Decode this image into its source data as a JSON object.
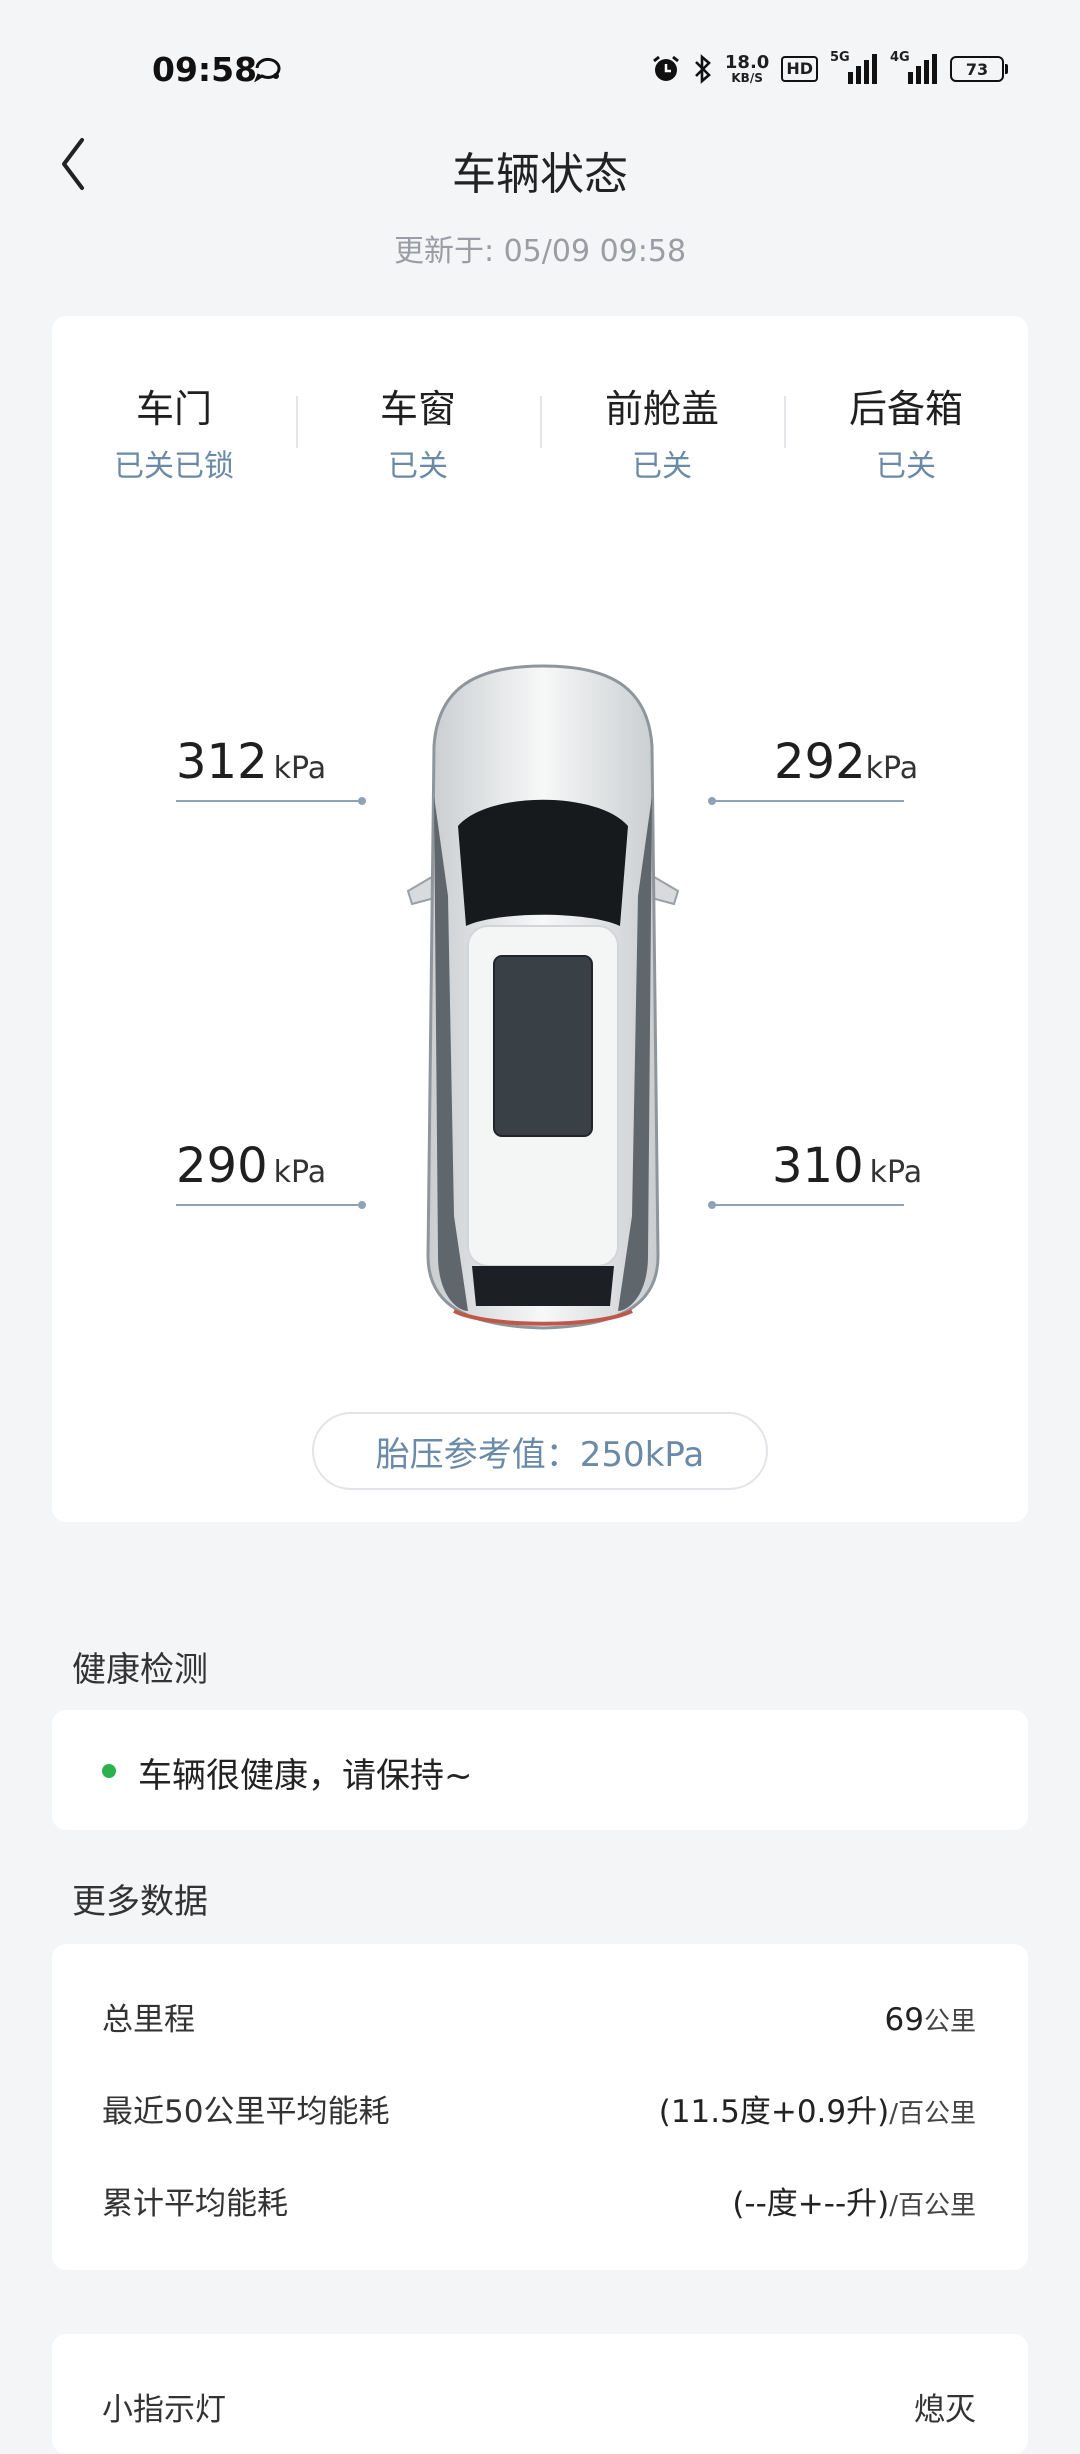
{
  "status_bar": {
    "time": "09:58",
    "net_speed_value": "18.0",
    "net_speed_unit": "KB/S",
    "hd_badge": "HD",
    "sig1_label": "5G",
    "sig2_label": "4G",
    "battery": "73",
    "icons": [
      "alarm-icon",
      "bluetooth-icon",
      "signal-icon",
      "battery-icon"
    ]
  },
  "header": {
    "title": "车辆状态",
    "update_time": "更新于: 05/09 09:58"
  },
  "vehicle_status": [
    {
      "label": "车门",
      "value": "已关已锁"
    },
    {
      "label": "车窗",
      "value": "已关"
    },
    {
      "label": "前舱盖",
      "value": "已关"
    },
    {
      "label": "后备箱",
      "value": "已关"
    }
  ],
  "tires": {
    "front_left": {
      "value": "312",
      "unit": "kPa"
    },
    "front_right": {
      "value": "292",
      "unit": "kPa"
    },
    "rear_left": {
      "value": "290",
      "unit": "kPa"
    },
    "rear_right": {
      "value": "310",
      "unit": "kPa"
    }
  },
  "tire_reference": "胎压参考值：250kPa",
  "health": {
    "section_title": "健康检测",
    "status_text": "车辆很健康，请保持~",
    "status_color": "#2bb24c"
  },
  "more_data": {
    "section_title": "更多数据",
    "rows": [
      {
        "label": "总里程",
        "value": "69",
        "unit": "公里"
      },
      {
        "label": "最近50公里平均能耗",
        "value": "(11.5度+0.9升)",
        "unit": "/百公里"
      },
      {
        "label": "累计平均能耗",
        "value": "(--度+--升)",
        "unit": "/百公里"
      }
    ]
  },
  "bottom_row": {
    "label": "小指示灯",
    "value": "熄灭"
  },
  "colors": {
    "accent_text": "#6b8aa7",
    "background": "#f4f5f7"
  }
}
